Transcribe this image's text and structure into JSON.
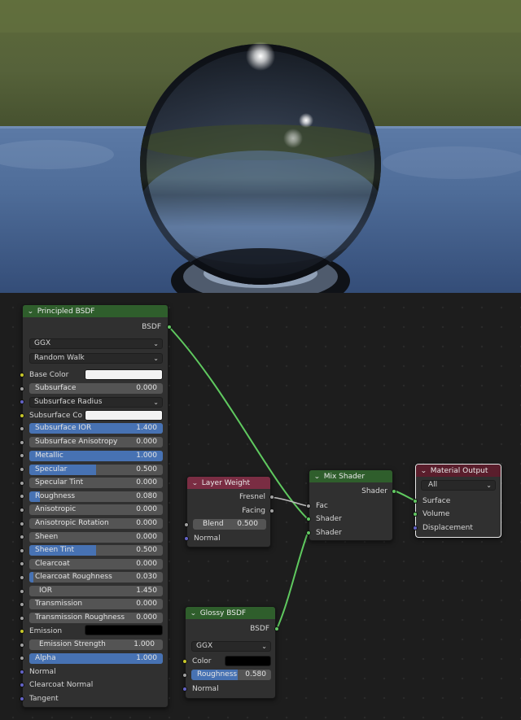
{
  "colors": {
    "shader_socket": "#63c763",
    "color_socket": "#c7c729",
    "vector_socket": "#6363c7",
    "value_socket": "#a1a1a1",
    "slider_fill": "#4772b3",
    "wire": "#5fc95f",
    "wire_gray": "#bdbdbd"
  },
  "principled": {
    "title": "Principled BSDF",
    "output": "BSDF",
    "distribution": "GGX",
    "subsurface_method": "Random Walk",
    "base_color_label": "Base Color",
    "base_color": "#f2f2f2",
    "subsurface": {
      "label": "Subsurface",
      "value": "0.000",
      "fill": 0
    },
    "subsurface_radius": "Subsurface Radius",
    "subsurface_color_label": "Subsurface Co",
    "subsurface_color": "#f2f2f2",
    "subsurface_ior": {
      "label": "Subsurface IOR",
      "value": "1.400",
      "fill": 1.0
    },
    "subsurface_anisotropy": {
      "label": "Subsurface Anisotropy",
      "value": "0.000",
      "fill": 0
    },
    "metallic": {
      "label": "Metallic",
      "value": "1.000",
      "fill": 1.0
    },
    "specular": {
      "label": "Specular",
      "value": "0.500",
      "fill": 0.5
    },
    "specular_tint": {
      "label": "Specular Tint",
      "value": "0.000",
      "fill": 0
    },
    "roughness": {
      "label": "Roughness",
      "value": "0.080",
      "fill": 0.08
    },
    "anisotropic": {
      "label": "Anisotropic",
      "value": "0.000",
      "fill": 0
    },
    "anisotropic_rotation": {
      "label": "Anisotropic Rotation",
      "value": "0.000",
      "fill": 0
    },
    "sheen": {
      "label": "Sheen",
      "value": "0.000",
      "fill": 0
    },
    "sheen_tint": {
      "label": "Sheen Tint",
      "value": "0.500",
      "fill": 0.5
    },
    "clearcoat": {
      "label": "Clearcoat",
      "value": "0.000",
      "fill": 0
    },
    "clearcoat_roughness": {
      "label": "Clearcoat Roughness",
      "value": "0.030",
      "fill": 0.03
    },
    "ior": {
      "label": "IOR",
      "value": "1.450",
      "fill": 0
    },
    "transmission": {
      "label": "Transmission",
      "value": "0.000",
      "fill": 0
    },
    "transmission_roughness": {
      "label": "Transmission Roughness",
      "value": "0.000",
      "fill": 0
    },
    "emission_label": "Emission",
    "emission_color": "#000000",
    "emission_strength": {
      "label": "Emission Strength",
      "value": "1.000",
      "fill": 0
    },
    "alpha": {
      "label": "Alpha",
      "value": "1.000",
      "fill": 1.0
    },
    "normal": "Normal",
    "clearcoat_normal": "Clearcoat Normal",
    "tangent": "Tangent"
  },
  "layer_weight": {
    "title": "Layer Weight",
    "fresnel": "Fresnel",
    "facing": "Facing",
    "blend": {
      "label": "Blend",
      "value": "0.500",
      "fill": 0
    },
    "normal": "Normal"
  },
  "glossy": {
    "title": "Glossy BSDF",
    "output": "BSDF",
    "distribution": "GGX",
    "color_label": "Color",
    "color": "#000000",
    "roughness": {
      "label": "Roughness",
      "value": "0.580",
      "fill": 0.58
    },
    "normal": "Normal"
  },
  "mix": {
    "title": "Mix Shader",
    "output": "Shader",
    "fac": "Fac",
    "shader1": "Shader",
    "shader2": "Shader"
  },
  "output": {
    "title": "Material Output",
    "target": "All",
    "surface": "Surface",
    "volume": "Volume",
    "displacement": "Displacement"
  }
}
